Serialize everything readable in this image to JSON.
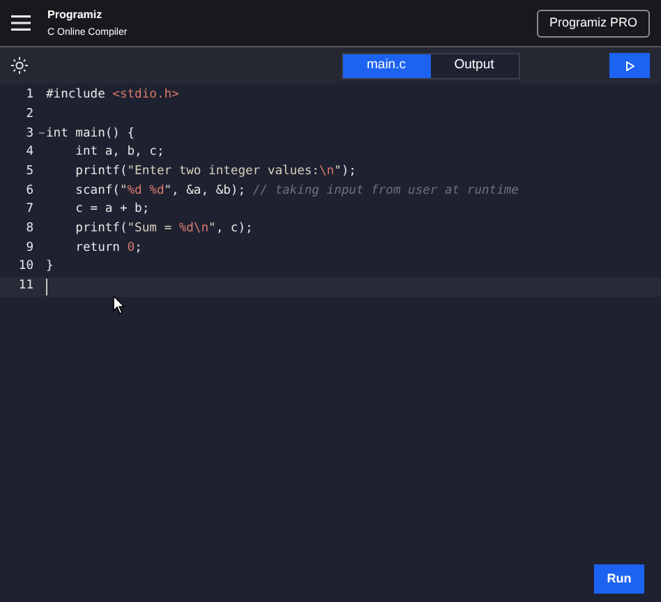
{
  "header": {
    "brand": "Programiz",
    "subtitle": "C Online Compiler",
    "pro_button": "Programiz PRO"
  },
  "tabs": [
    {
      "label": "main.c",
      "selected": true
    },
    {
      "label": "Output",
      "selected": false
    }
  ],
  "editor": {
    "lines": [
      {
        "number": "1",
        "active": false,
        "foldable": false,
        "tokens": [
          {
            "text": "#include ",
            "kind": "plain"
          },
          {
            "text": "<stdio.h>",
            "kind": "string"
          }
        ]
      },
      {
        "number": "2",
        "active": false,
        "foldable": false
      },
      {
        "number": "3",
        "active": false,
        "foldable": true,
        "tokens": [
          {
            "text": "int main() {",
            "kind": "plain"
          }
        ]
      },
      {
        "number": "4",
        "active": false,
        "foldable": false,
        "tokens": [
          {
            "text": "    int a, b, c;",
            "kind": "plain"
          }
        ]
      },
      {
        "number": "5",
        "active": false,
        "foldable": false,
        "tokens": [
          {
            "text": "    printf(",
            "kind": "plain"
          },
          {
            "text": "\"Enter two integer values:",
            "kind": "text"
          },
          {
            "text": "\\n",
            "kind": "string"
          },
          {
            "text": "\"",
            "kind": "text"
          },
          {
            "text": ");",
            "kind": "plain"
          }
        ]
      },
      {
        "number": "6",
        "active": false,
        "foldable": false,
        "tokens": [
          {
            "text": "    scanf(",
            "kind": "plain"
          },
          {
            "text": "\"",
            "kind": "text"
          },
          {
            "text": "%d %d",
            "kind": "string"
          },
          {
            "text": "\"",
            "kind": "text"
          },
          {
            "text": ", &a, &b); ",
            "kind": "plain"
          },
          {
            "text": "// taking input from user at runtime",
            "kind": "comment"
          }
        ]
      },
      {
        "number": "7",
        "active": false,
        "foldable": false,
        "tokens": [
          {
            "text": "    c = a + b;",
            "kind": "plain"
          }
        ]
      },
      {
        "number": "8",
        "active": false,
        "foldable": false,
        "tokens": [
          {
            "text": "    printf(",
            "kind": "plain"
          },
          {
            "text": "\"Sum = ",
            "kind": "text"
          },
          {
            "text": "%d\\n",
            "kind": "string"
          },
          {
            "text": "\"",
            "kind": "text"
          },
          {
            "text": ", c);",
            "kind": "plain"
          }
        ]
      },
      {
        "number": "9",
        "active": false,
        "foldable": false,
        "tokens": [
          {
            "text": "    return ",
            "kind": "plain"
          },
          {
            "text": "0",
            "kind": "string"
          },
          {
            "text": ";",
            "kind": "plain"
          }
        ]
      },
      {
        "number": "10",
        "active": false,
        "foldable": false,
        "tokens": [
          {
            "text": "}",
            "kind": "plain"
          }
        ]
      },
      {
        "number": "11",
        "active": true,
        "foldable": false
      }
    ]
  },
  "run_button": "Run"
}
